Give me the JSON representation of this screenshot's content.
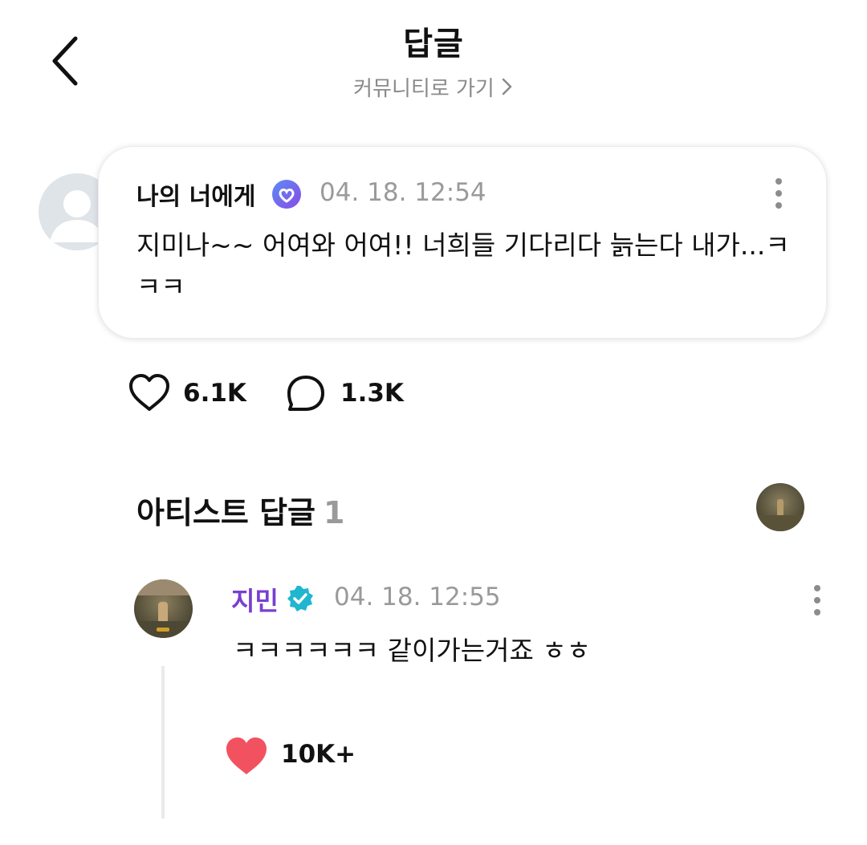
{
  "header": {
    "title": "답글",
    "subtitle": "커뮤니티로 가기"
  },
  "post": {
    "author": "나의 너에게",
    "time": "04. 18. 12:54",
    "text": "지미나~~ 어여와 어여!!  너희들 기다리다 늙는다 내가...ㅋㅋㅋ",
    "likes": "6.1K",
    "comments": "1.3K"
  },
  "artist_section": {
    "title": "아티스트 답글",
    "count": "1"
  },
  "reply": {
    "author": "지민",
    "time": "04. 18. 12:55",
    "text": "ㅋㅋㅋㅋㅋㅋ 같이가는거죠 ㅎㅎ",
    "likes": "10K+"
  },
  "colors": {
    "artist_name": "#7a3ed1",
    "like_heart": "#f2525f",
    "verified_user": "#6a63f0",
    "verified_artist": "#1fb6cf"
  }
}
